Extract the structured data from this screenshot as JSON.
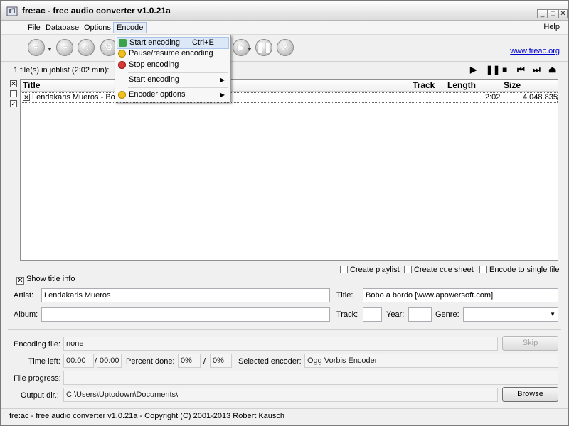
{
  "window": {
    "title": "fre:ac - free audio converter v1.0.21a"
  },
  "menubar": {
    "file": "File",
    "database": "Database",
    "options": "Options",
    "encode": "Encode",
    "help": "Help"
  },
  "toolbar": {
    "link": "www.freac.org"
  },
  "encode_menu": {
    "items": [
      {
        "label": "Start encoding",
        "shortcut": "Ctrl+E",
        "icon": "play-icon",
        "color": "#3da34a"
      },
      {
        "label": "Pause/resume encoding",
        "icon": "pause-icon",
        "color": "#f0c020"
      },
      {
        "label": "Stop encoding",
        "icon": "stop-icon",
        "color": "#d83838"
      },
      {
        "label": "Start encoding",
        "icon": "submenu-arrow-icon"
      },
      {
        "label": "Encoder options",
        "icon": "gear-icon",
        "color": "#f0c020"
      }
    ]
  },
  "joblist": {
    "count_text": "1 file(s) in joblist (2:02 min):",
    "columns": {
      "title": "Title",
      "track": "Track",
      "length": "Length",
      "size": "Size"
    },
    "rows": [
      {
        "title": "Lendakaris Mueros - Bobo",
        "length": "2:02",
        "size": "4.048.835",
        "checked": "✕"
      }
    ]
  },
  "options": {
    "create_playlist": "Create playlist",
    "create_cue": "Create cue sheet",
    "single_file": "Encode to single file"
  },
  "title_info": {
    "show_label": "Show title info",
    "artist_label": "Artist:",
    "artist": "Lendakaris Mueros",
    "title_label": "Title:",
    "title": "Bobo a bordo [www.apowersoft.com]",
    "album_label": "Album:",
    "album": "",
    "track_label": "Track:",
    "track": "",
    "year_label": "Year:",
    "year": "",
    "genre_label": "Genre:",
    "genre": ""
  },
  "encoding": {
    "file_label": "Encoding file:",
    "file": "none",
    "skip": "Skip",
    "time_left_label": "Time left:",
    "time_left": "00:00",
    "time_total": "00:00",
    "percent_label": "Percent done:",
    "percent": "0%",
    "percent_total": "0%",
    "encoder_label": "Selected encoder:",
    "encoder": "Ogg Vorbis Encoder",
    "progress_label": "File progress:",
    "progress": 0,
    "output_label": "Output dir.:",
    "output_dir": "C:\\Users\\Uptodown\\Documents\\",
    "browse": "Browse"
  },
  "statusbar": {
    "text": "fre:ac - free audio converter v1.0.21a - Copyright (C) 2001-2013 Robert Kausch"
  }
}
